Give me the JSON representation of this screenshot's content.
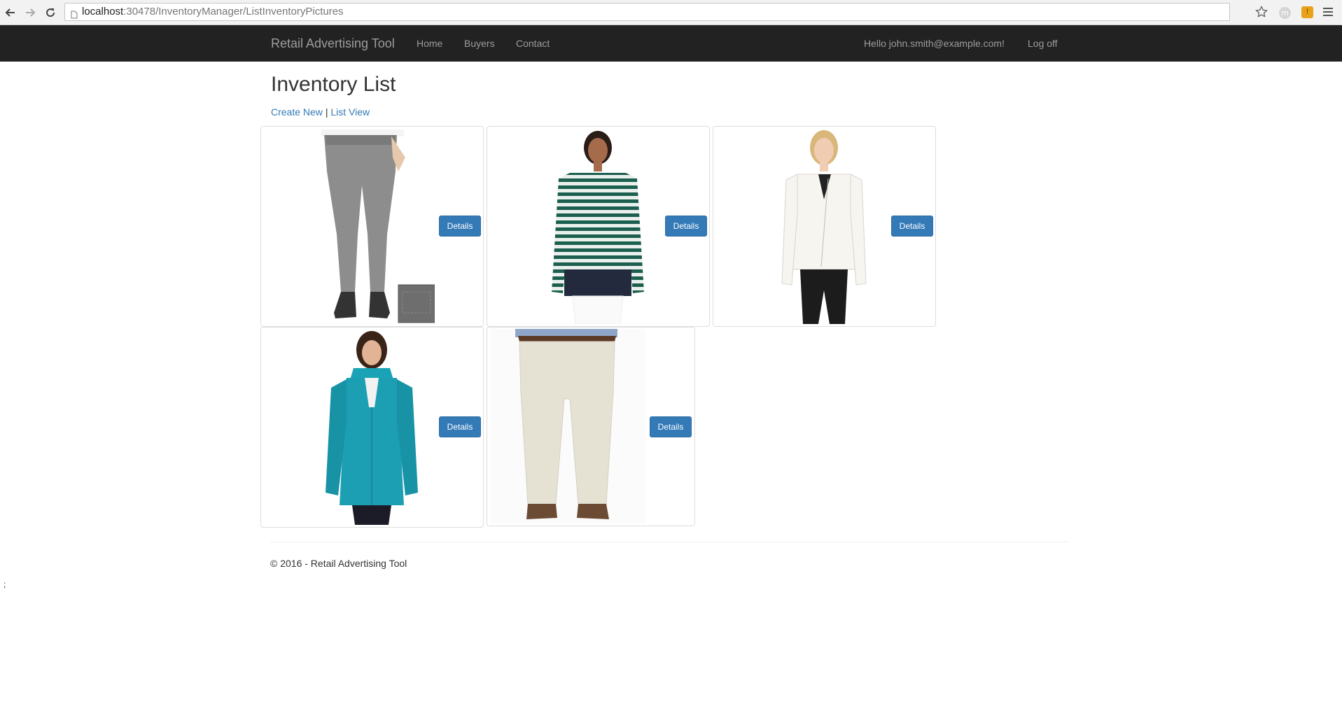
{
  "browser": {
    "url_host": "localhost",
    "url_rest": ":30478/InventoryManager/ListInventoryPictures"
  },
  "navbar": {
    "brand": "Retail Advertising Tool",
    "links": [
      "Home",
      "Buyers",
      "Contact"
    ],
    "greeting": "Hello john.smith@example.com!",
    "logoff": "Log off"
  },
  "page": {
    "title": "Inventory List",
    "create_new": "Create New",
    "separator": "|",
    "list_view": "List View"
  },
  "items": [
    {
      "name": "gray-jeans",
      "button": "Details"
    },
    {
      "name": "striped-top",
      "button": "Details"
    },
    {
      "name": "white-jacket",
      "button": "Details"
    },
    {
      "name": "teal-jacket",
      "button": "Details"
    },
    {
      "name": "khaki-pants",
      "button": "Details"
    }
  ],
  "footer": {
    "text": "© 2016 - Retail Advertising Tool",
    "stray": ";"
  },
  "colors": {
    "navbar_bg": "#222222",
    "navbar_text": "#9d9d9d",
    "link": "#337ab7",
    "button": "#337ab7"
  },
  "icons": [
    "back-arrow-icon",
    "forward-arrow-icon",
    "reload-icon",
    "page-icon",
    "star-icon",
    "extension-icon",
    "extension-icon",
    "menu-icon"
  ]
}
